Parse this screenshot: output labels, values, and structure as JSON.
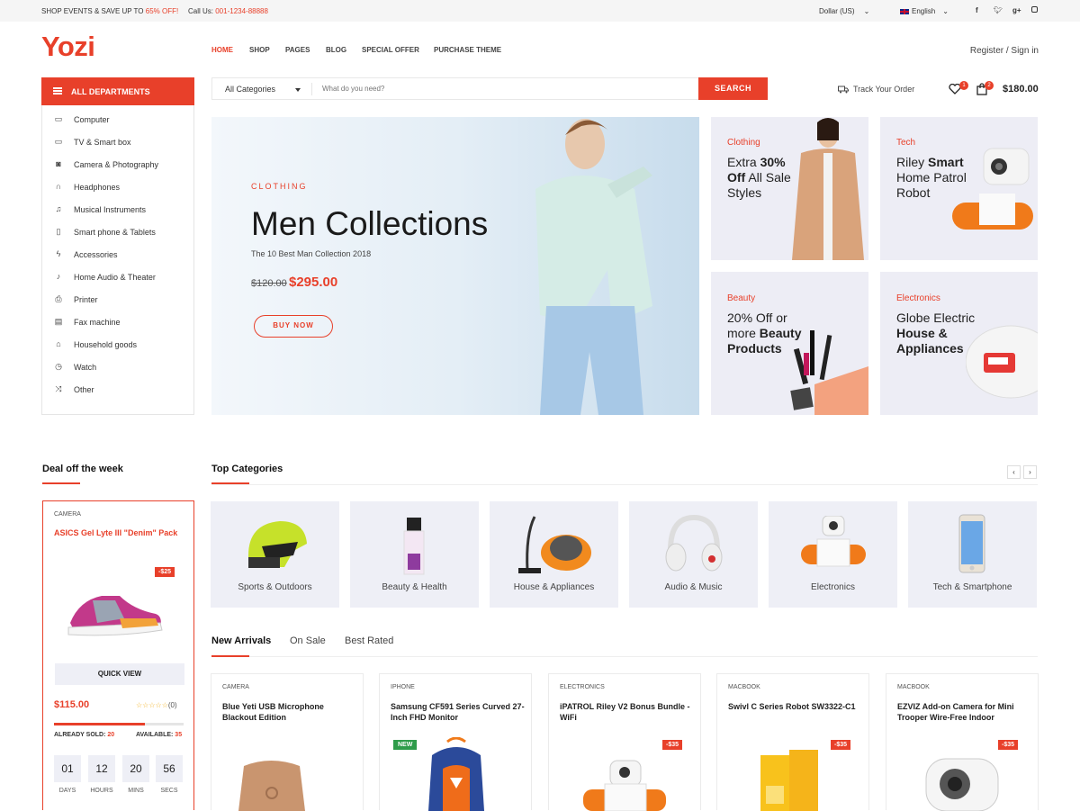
{
  "topbar": {
    "promo_prefix": "SHOP EVENTS & SAVE UP TO ",
    "promo_highlight": "65% OFF!",
    "call_label": "Call Us: ",
    "call_number": "001-1234-88888",
    "currency": "Dollar (US)",
    "language": "English",
    "social_icons": [
      "facebook-icon",
      "twitter-icon",
      "google-plus-icon",
      "instagram-icon"
    ]
  },
  "header": {
    "logo": "Yozi",
    "nav": [
      "HOME",
      "SHOP",
      "PAGES",
      "BLOG",
      "SPECIAL OFFER",
      "PURCHASE THEME"
    ],
    "register_signin": "Register / Sign in"
  },
  "departments": {
    "title": "ALL DEPARTMENTS",
    "items": [
      {
        "label": "Computer",
        "icon": "laptop-icon"
      },
      {
        "label": "TV & Smart box",
        "icon": "tv-icon"
      },
      {
        "label": "Camera & Photography",
        "icon": "camera-icon"
      },
      {
        "label": "Headphones",
        "icon": "headphones-icon"
      },
      {
        "label": "Musical Instruments",
        "icon": "music-icon"
      },
      {
        "label": "Smart phone & Tablets",
        "icon": "phone-icon"
      },
      {
        "label": "Accessories",
        "icon": "bolt-icon"
      },
      {
        "label": "Home Audio & Theater",
        "icon": "microphone-icon"
      },
      {
        "label": "Printer",
        "icon": "printer-icon"
      },
      {
        "label": "Fax machine",
        "icon": "fax-icon"
      },
      {
        "label": "Household goods",
        "icon": "home-icon"
      },
      {
        "label": "Watch",
        "icon": "clock-icon"
      },
      {
        "label": "Other",
        "icon": "shuffle-icon"
      }
    ]
  },
  "search": {
    "category": "All Categories",
    "placeholder": "What do you need?",
    "button": "SEARCH"
  },
  "header_right": {
    "track_order": "Track Your Order",
    "wishlist_count": "1",
    "cart_count": "2",
    "cart_total": "$180.00"
  },
  "hero": {
    "eyebrow": "CLOTHING",
    "title": "Men Collections",
    "subtitle": "The 10 Best Man Collection 2018",
    "old_price": "$120.00",
    "new_price": "$295.00",
    "button": "BUY NOW"
  },
  "promos": [
    {
      "category": "Clothing",
      "line1": "Extra ",
      "bold1": "30%",
      "line2": "Off",
      "rest": " All Sale Styles"
    },
    {
      "category": "Tech",
      "line1": "Riley ",
      "bold1": "Smart",
      "line2": "",
      "rest": "Home Patrol Robot"
    },
    {
      "category": "Beauty",
      "line1": "20% Off or more ",
      "bold1": "Beauty Products",
      "line2": "",
      "rest": ""
    },
    {
      "category": "Electronics",
      "line1": "Globe Electric ",
      "bold1": "House & Appliances",
      "line2": "",
      "rest": ""
    }
  ],
  "deal": {
    "title": "Deal off the week",
    "category": "CAMERA",
    "name": "ASICS Gel Lyte III \"Denim\" Pack",
    "discount": "-$25",
    "quick_view": "QUICK VIEW",
    "price": "$115.00",
    "rating_count": "(0)",
    "rating": 0,
    "sold_label": "ALREADY SOLD: ",
    "sold": "20",
    "available_label": "AVAILABLE: ",
    "available": "35",
    "sold_fraction": 0.7,
    "countdown": [
      {
        "value": "01",
        "label": "DAYS"
      },
      {
        "value": "12",
        "label": "HOURS"
      },
      {
        "value": "20",
        "label": "MINS"
      },
      {
        "value": "56",
        "label": "SECS"
      }
    ]
  },
  "top_categories": {
    "title": "Top Categories",
    "prev": "‹",
    "next": "›",
    "items": [
      "Sports & Outdoors",
      "Beauty & Health",
      "House & Appliances",
      "Audio & Music",
      "Electronics",
      "Tech & Smartphone"
    ]
  },
  "product_tabs": [
    "New Arrivals",
    "On Sale",
    "Best Rated"
  ],
  "products": [
    {
      "category": "CAMERA",
      "name": "Blue Yeti USB Microphone Blackout Edition",
      "badge": ""
    },
    {
      "category": "IPHONE",
      "name": "Samsung CF591 Series Curved 27-Inch FHD Monitor",
      "badge": "NEW"
    },
    {
      "category": "ELECTRONICS",
      "name": "iPATROL Riley V2 Bonus Bundle - WiFi",
      "badge": "-$35"
    },
    {
      "category": "MACBOOK",
      "name": "Swivl C Series Robot SW3322-C1",
      "badge": "-$35"
    },
    {
      "category": "MACBOOK",
      "name": "EZVIZ Add-on Camera for Mini Trooper Wire-Free Indoor",
      "badge": "-$35"
    }
  ],
  "colors": {
    "accent": "#e8402a",
    "new_badge": "#2e9c4a",
    "card_bg": "#eeeff6"
  }
}
